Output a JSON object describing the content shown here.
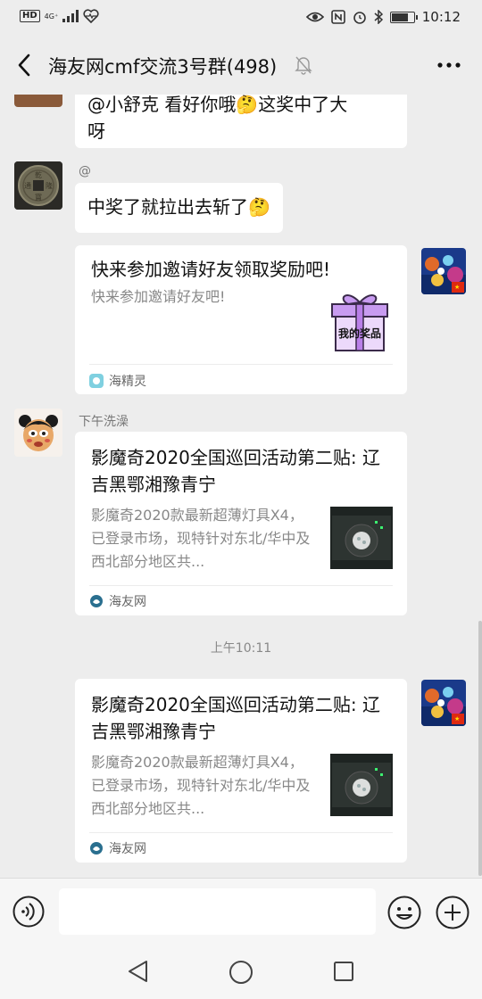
{
  "status_bar": {
    "network_badge": "HD",
    "network_type": "4G⁺",
    "time": "10:12"
  },
  "header": {
    "title": "海友网cmf交流3号群(498)"
  },
  "messages": {
    "partial_bubble": {
      "line1": "@小舒克 看好你哦🤔这奖中了大",
      "line2": "呀"
    },
    "msg2": {
      "sender": "@",
      "text": "中奖了就拉出去斩了",
      "emoji": "🤔"
    },
    "invite_card": {
      "title": "快来参加邀请好友领取奖励吧!",
      "desc": "快来参加邀请好友吧!",
      "gift_label": "我的奖品",
      "source": "海精灵"
    },
    "article1": {
      "sender": "下午洗澡",
      "title": "影魔奇2020全国巡回活动第二贴: 辽吉黑鄂湘豫青宁",
      "desc": "影魔奇2020款最新超薄灯具X4，已登录市场，现特针对东北/华中及西北部分地区共...",
      "source": "海友网"
    },
    "time_separator": "上午10:11",
    "article2": {
      "title": "影魔奇2020全国巡回活动第二贴: 辽吉黑鄂湘豫青宁",
      "desc": "影魔奇2020款最新超薄灯具X4，已登录市场，现特针对东北/华中及西北部分地区共...",
      "source": "海友网"
    }
  },
  "input_bar": {
    "placeholder": ""
  },
  "colors": {
    "background": "#ededed",
    "bubble": "#ffffff",
    "gift_purple": "#b97fe8",
    "flag_red": "#de2910"
  }
}
